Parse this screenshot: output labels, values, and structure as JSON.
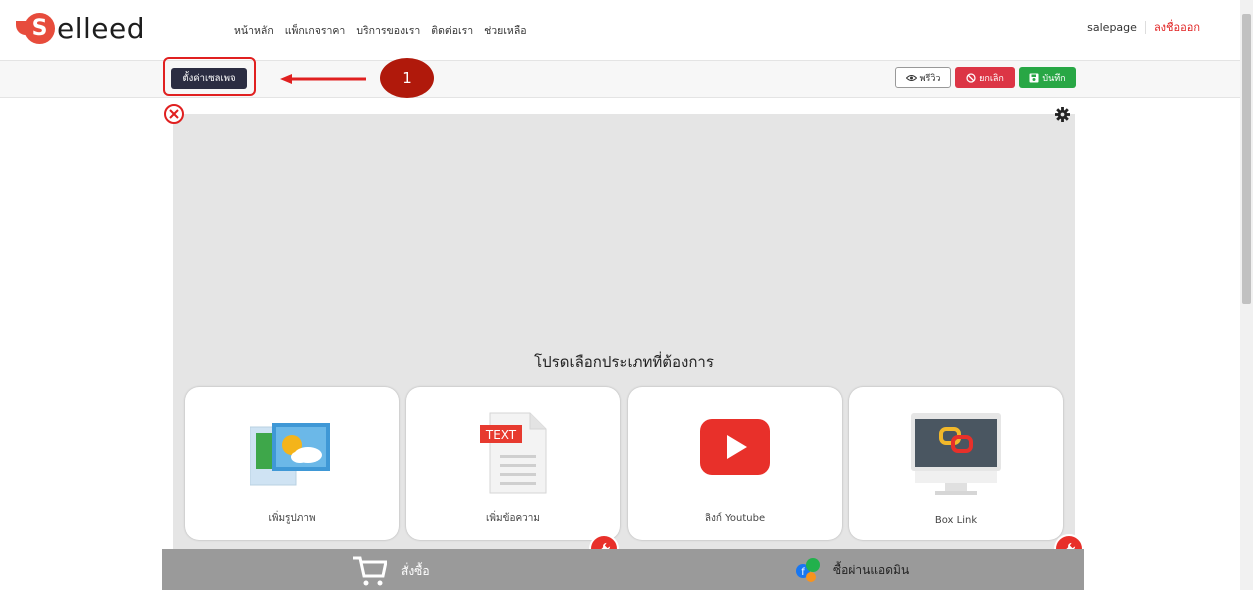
{
  "brand": {
    "logo_letter": "S",
    "logo_text": "elleed",
    "accent": "#e74c3c"
  },
  "nav": {
    "items": [
      "หน้าหลัก",
      "แพ็กเกจราคา",
      "บริการของเรา",
      "ติดต่อเรา",
      "ช่วยเหลือ"
    ]
  },
  "user": {
    "name": "salepage",
    "logout": "ลงชื่อออก"
  },
  "toolbar": {
    "setting_label": "ตั้งค่าเซลเพจ",
    "step_number": "1",
    "preview_label": "พรีวิว",
    "cancel_label": "ยกเลิก",
    "save_label": "บันทึก"
  },
  "content": {
    "prompt": "โปรดเลือกประเภทที่ต้องการ",
    "cards": [
      {
        "label": "เพิ่มรูปภาพ",
        "icon": "image-icon"
      },
      {
        "label": "เพิ่มข้อความ",
        "icon": "text-document-icon",
        "icon_text": "TEXT"
      },
      {
        "label": "ลิงก์ Youtube",
        "icon": "youtube-play-icon"
      },
      {
        "label": "Box Link",
        "icon": "box-link-icon"
      }
    ]
  },
  "bottom": {
    "order_label": "สั่งซื้อ",
    "admin_label": "ซื้อผ่านแอดมิน"
  },
  "colors": {
    "danger": "#dc3545",
    "success": "#28a745",
    "dark": "#2b2d42",
    "step": "#b0190b"
  }
}
